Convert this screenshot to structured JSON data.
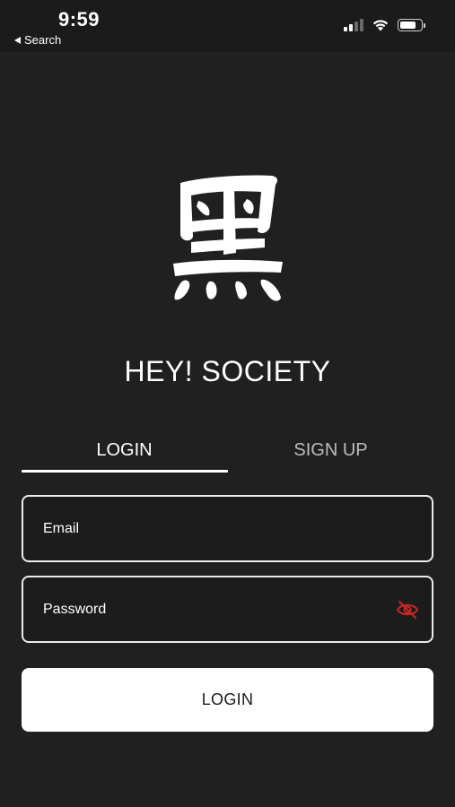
{
  "status_bar": {
    "time": "9:59",
    "back_label": "Search",
    "icons": [
      "signal-icon",
      "wifi-icon",
      "battery-icon"
    ]
  },
  "logo": {
    "glyph": "黑",
    "icon": "kanji-logo-icon"
  },
  "app_title": "HEY! SOCIETY",
  "tabs": [
    {
      "label": "LOGIN",
      "active": true
    },
    {
      "label": "SIGN UP",
      "active": false
    }
  ],
  "form": {
    "email_placeholder": "Email",
    "email_value": "",
    "password_placeholder": "Password",
    "password_value": "",
    "password_toggle_icon": "eye-off-icon",
    "submit_label": "LOGIN"
  },
  "colors": {
    "background": "#202020",
    "text": "#ffffff",
    "inactive_tab": "#bdbdbd",
    "eye_icon": "#c62828",
    "button_bg": "#ffffff",
    "button_text": "#1a1a1a"
  }
}
